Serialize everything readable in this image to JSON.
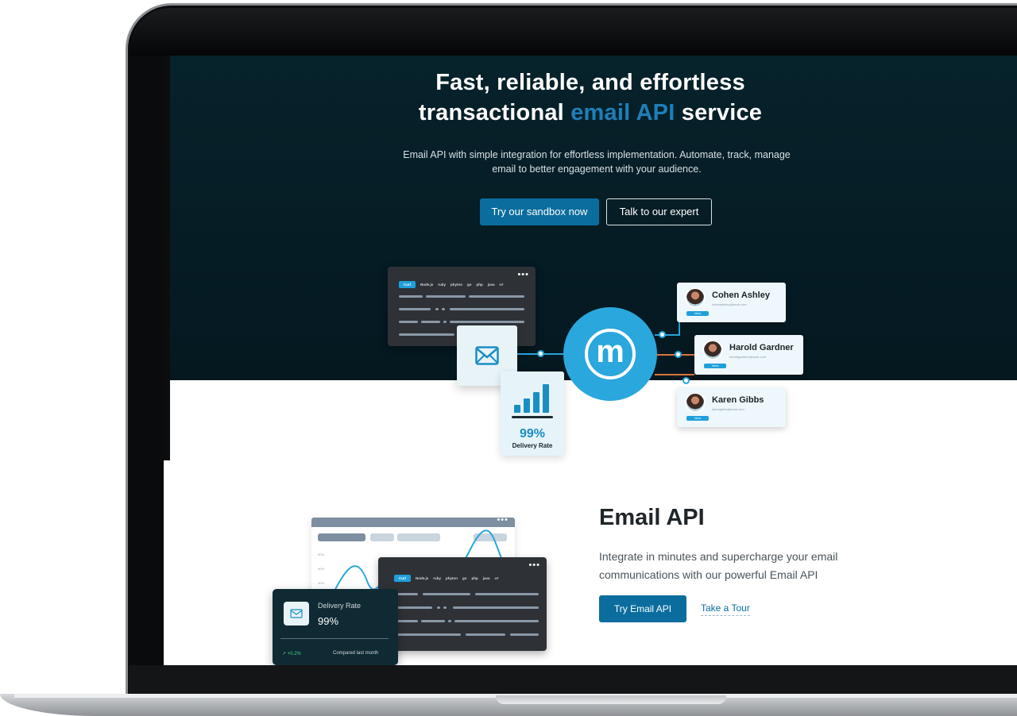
{
  "hero": {
    "title_line1": "Fast, reliable, and effortless",
    "title_line2_pre": "transactional ",
    "title_line2_accent": "email API",
    "title_line2_post": " service",
    "subtitle": "Email API with simple integration for effortless implementation. Automate, track, manage email to better engagement with your audience.",
    "primary_button": "Try our sandbox now",
    "secondary_button": "Talk to our expert"
  },
  "illustration": {
    "code_tabs": [
      "Curl",
      "Node.js",
      "ruby",
      "phyton",
      "go",
      "php",
      "java",
      "c#"
    ],
    "logo_letter": "m",
    "recipients": [
      {
        "name": "Cohen Ashley",
        "email": "cohenashley@work.com",
        "tag": "Inbox"
      },
      {
        "name": "Harold Gardner",
        "email": "haroldgardner@work.com",
        "tag": "Inbox"
      },
      {
        "name": "Karen Gibbs",
        "email": "karengibbs@work.com",
        "tag": "Inbox"
      }
    ],
    "delivery_value": "99%",
    "delivery_label": "Delivery Rate"
  },
  "email_api": {
    "title": "Email API",
    "description": "Integrate in minutes and supercharge your email communications with our powerful Email API",
    "button": "Try Email API",
    "link": "Take a Tour",
    "dashboard_axis": [
      "80%",
      "60%",
      "40%"
    ],
    "code_tabs": [
      "Curl",
      "Node.js",
      "ruby",
      "phyton",
      "go",
      "php",
      "java",
      "c#"
    ],
    "rate_card": {
      "title": "Delivery Rate",
      "value": "99%",
      "trend": "+0.2%",
      "compare": "Compared last month"
    }
  },
  "colors": {
    "hero_bg": "#06222b",
    "accent": "#1e7fb8",
    "primary_button": "#0a6d9e",
    "logo_blue": "#2aa7dd"
  }
}
